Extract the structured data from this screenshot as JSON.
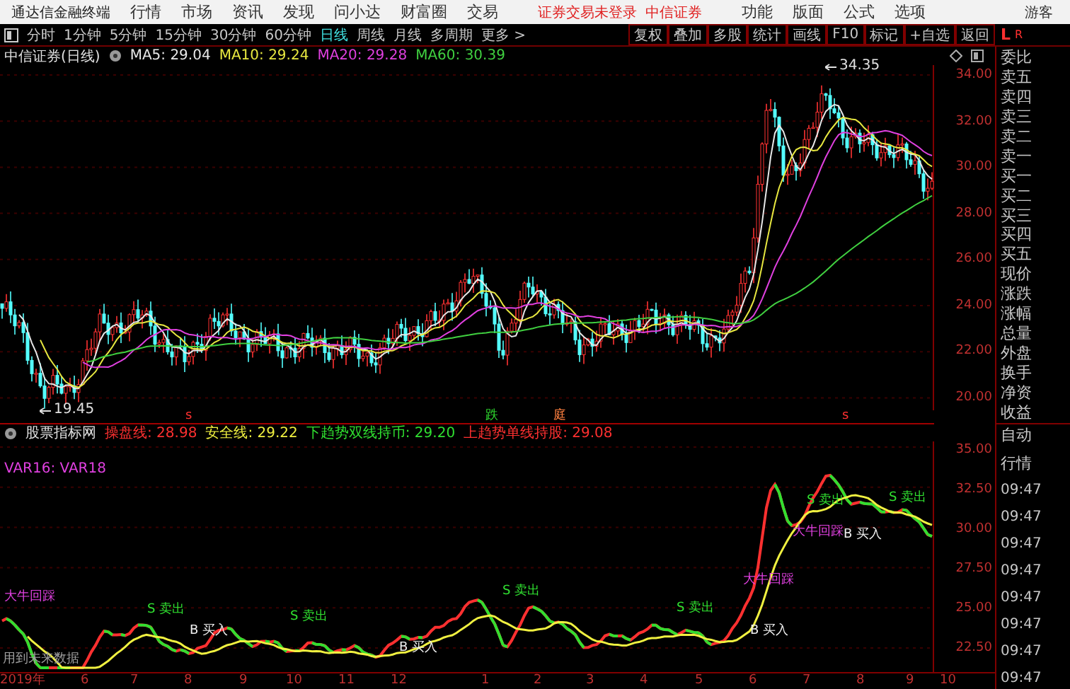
{
  "menu_bar": {
    "app_name": "通达信金融终端",
    "menus": [
      "行情",
      "市场",
      "资讯",
      "发现",
      "问小达",
      "财富圈",
      "交易"
    ],
    "login_status": "证券交易未登录",
    "broker": "中信证券",
    "tools": [
      "功能",
      "版面",
      "公式",
      "选项"
    ],
    "user": "游客"
  },
  "period_tabs": [
    {
      "label": "分时",
      "selected": false
    },
    {
      "label": "1分钟",
      "selected": false
    },
    {
      "label": "5分钟",
      "selected": false
    },
    {
      "label": "15分钟",
      "selected": false
    },
    {
      "label": "30分钟",
      "selected": false
    },
    {
      "label": "60分钟",
      "selected": false
    },
    {
      "label": "日线",
      "selected": true
    },
    {
      "label": "周线",
      "selected": false
    },
    {
      "label": "月线",
      "selected": false
    },
    {
      "label": "多周期",
      "selected": false
    },
    {
      "label": "更多 >",
      "selected": false
    }
  ],
  "tool_buttons": [
    "复权",
    "叠加",
    "多股",
    "统计",
    "画线",
    "F10",
    "标记",
    "+自选",
    "返回"
  ],
  "corner": {
    "left": "L",
    "right": "R"
  },
  "price_chart": {
    "title": "中信证券(日线)",
    "ma_lines": [
      {
        "label": "MA5: 29.04",
        "color": "#e8e8e8"
      },
      {
        "label": "MA10: 29.24",
        "color": "#e8e840"
      },
      {
        "label": "MA20: 29.28",
        "color": "#e040e0"
      },
      {
        "label": "MA60: 30.39",
        "color": "#40d040"
      }
    ],
    "price_ticks": [
      "34.00",
      "32.00",
      "30.00",
      "28.00",
      "26.00",
      "24.00",
      "22.00",
      "20.00"
    ],
    "high_label": "34.35",
    "low_label": "19.45",
    "event_marks": [
      {
        "text": "s",
        "color": "#ff3030"
      },
      {
        "text": "跌",
        "color": "#30e030"
      },
      {
        "text": "庭",
        "color": "#ff8040"
      },
      {
        "text": "s",
        "color": "#ff3030"
      }
    ]
  },
  "indicator": {
    "name": "股票指标网",
    "lines": [
      {
        "text": "操盘线: 28.98",
        "color": "#ff3030"
      },
      {
        "text": "安全线: 29.22",
        "color": "#f0f040"
      },
      {
        "text": "下趋势双线持币: 29.20",
        "color": "#30e030"
      },
      {
        "text": "上趋势单线持股: 29.08",
        "color": "#ff3030"
      }
    ],
    "var_label": "VAR16: VAR18",
    "warning": "用到未来数据",
    "ticks": [
      "35.00",
      "32.50",
      "30.00",
      "27.50",
      "25.00",
      "22.50"
    ],
    "signals": [
      {
        "kind": "pullback",
        "text": "大牛回踩"
      },
      {
        "kind": "sell",
        "text": "S 卖出"
      },
      {
        "kind": "buy",
        "text": "B 买入"
      },
      {
        "kind": "sell",
        "text": "S 卖出"
      },
      {
        "kind": "buy",
        "text": "B 买入"
      },
      {
        "kind": "sell",
        "text": "S 卖出"
      },
      {
        "kind": "pullback",
        "text": "大牛回踩"
      },
      {
        "kind": "sell",
        "text": "S 卖出"
      },
      {
        "kind": "buy",
        "text": "B 买入"
      },
      {
        "kind": "sell",
        "text": "S 卖出"
      },
      {
        "kind": "pullback",
        "text": "大牛回踩"
      },
      {
        "kind": "buy",
        "text": "B 买入"
      },
      {
        "kind": "sell",
        "text": "S 卖出"
      }
    ]
  },
  "date_axis": [
    "2019年",
    "6",
    "7",
    "8",
    "9",
    "10",
    "11",
    "12",
    "1",
    "2",
    "3",
    "4",
    "5",
    "6",
    "7",
    "8",
    "9",
    "10"
  ],
  "quote_panel": {
    "fields": [
      "委比",
      "卖五",
      "卖四",
      "卖三",
      "卖二",
      "卖一",
      "买一",
      "买二",
      "买三",
      "买四",
      "买五",
      "现价",
      "涨跌",
      "涨幅",
      "总量",
      "外盘",
      "换手",
      "净资",
      "收益"
    ],
    "ticker_labels": [
      "自动",
      "行情"
    ],
    "times": [
      "09:47",
      "09:47",
      "09:47",
      "09:47",
      "09:47",
      "09:47",
      "09:47",
      "09:47"
    ]
  }
}
